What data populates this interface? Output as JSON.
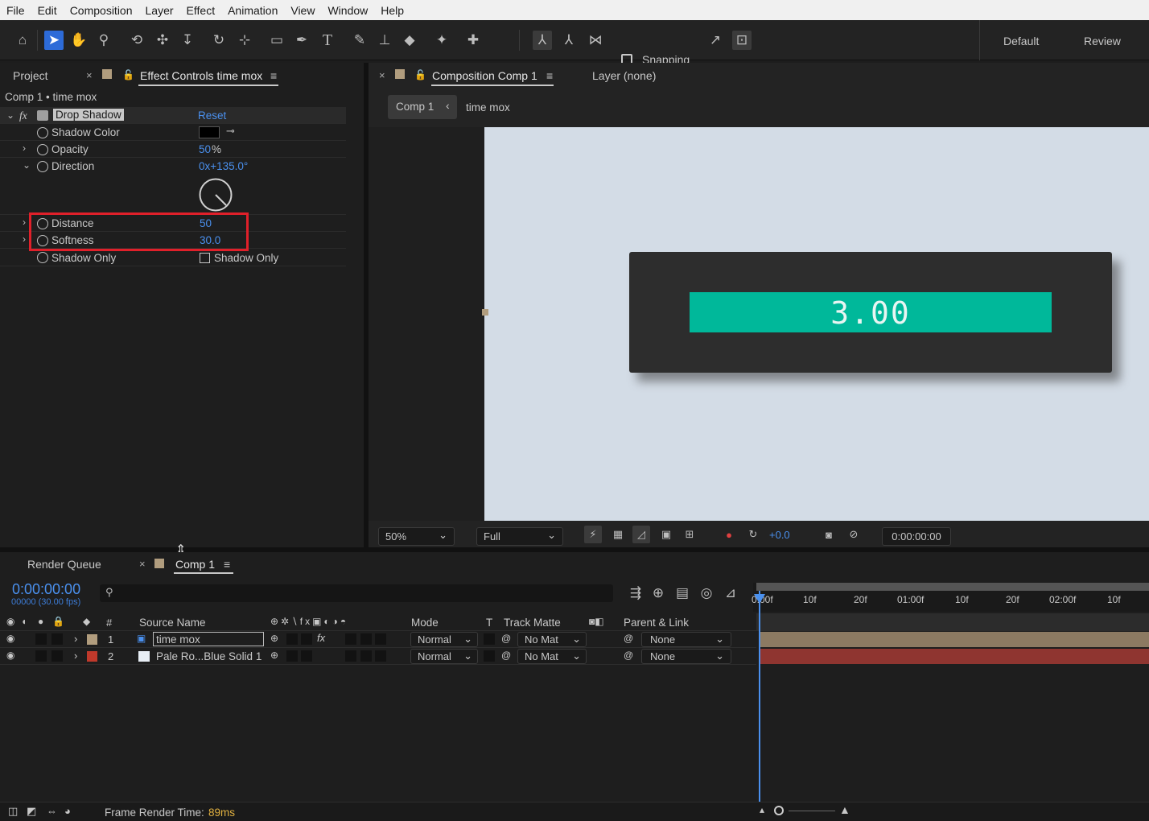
{
  "menu": [
    "File",
    "Edit",
    "Composition",
    "Layer",
    "Effect",
    "Animation",
    "View",
    "Window",
    "Help"
  ],
  "toolbar": {
    "snapping_label": "Snapping",
    "workspaces": [
      "Default",
      "Review"
    ]
  },
  "left_panel": {
    "tab_project": "Project",
    "tab_effect_controls": "Effect Controls time mox",
    "breadcrumb": "Comp 1 • time mox",
    "effect": {
      "fx_label": "fx",
      "name": "Drop Shadow",
      "reset_label": "Reset",
      "properties": [
        {
          "label": "Shadow Color",
          "value": ""
        },
        {
          "label": "Opacity",
          "value": "50",
          "unit": "%"
        },
        {
          "label": "Direction",
          "value": "0x+135.0°"
        },
        {
          "label": "Distance",
          "value": "50"
        },
        {
          "label": "Softness",
          "value": "30.0"
        },
        {
          "label": "Shadow Only",
          "value": "Shadow Only",
          "checked": false
        }
      ]
    }
  },
  "viewer": {
    "tab_composition": "Composition Comp 1",
    "tab_layer": "Layer (none)",
    "breadcrumb_comp": "Comp 1",
    "breadcrumb_layer": "time mox",
    "timer_text": "3.00",
    "zoom": "50%",
    "resolution": "Full",
    "exposure": "+0.0",
    "timecode": "0:00:00:00",
    "colors": {
      "canvas": "#d3dce6",
      "box": "#2d2d2d",
      "bar": "#00b89a"
    }
  },
  "timeline": {
    "tab_render_queue": "Render Queue",
    "tab_comp": "Comp 1",
    "current_time": "0:00:00:00",
    "frame_info": "00000 (30.00 fps)",
    "columns": {
      "num": "#",
      "source": "Source Name",
      "mode": "Mode",
      "t": "T",
      "track_matte": "Track Matte",
      "parent": "Parent & Link"
    },
    "ruler_labels": [
      "0:00f",
      "10f",
      "20f",
      "01:00f",
      "10f",
      "20f",
      "02:00f",
      "10f"
    ],
    "layers": [
      {
        "num": "1",
        "name": "time mox",
        "mode": "Normal",
        "matte": "No Mat",
        "parent": "None",
        "label_color": "#b19d7e",
        "bar_color": "#8c7a62"
      },
      {
        "num": "2",
        "name": "Pale Ro...Blue Solid 1",
        "mode": "Normal",
        "matte": "No Mat",
        "parent": "None",
        "label_color": "#c0392b",
        "bar_color": "#8f3530"
      }
    ],
    "footer_label": "Frame Render Time:",
    "footer_value": "89ms"
  }
}
